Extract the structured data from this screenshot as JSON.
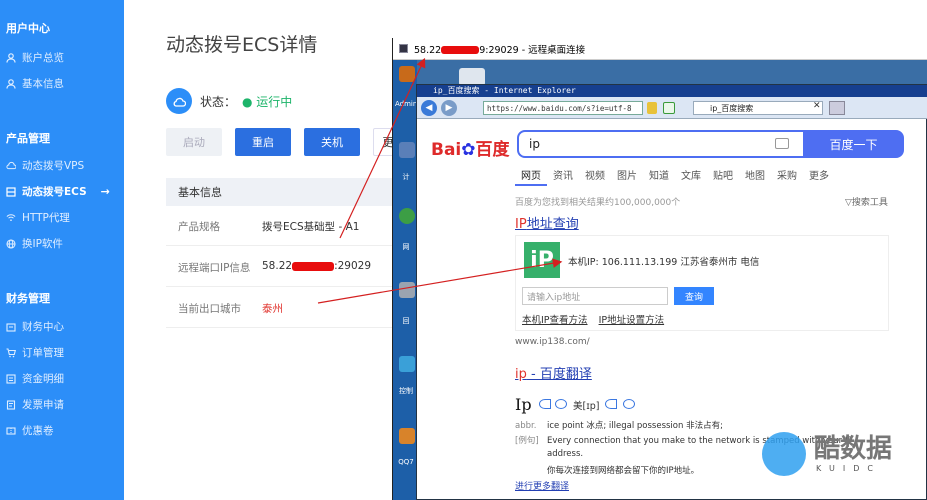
{
  "sidebar": {
    "sections": [
      {
        "title": "用户中心",
        "items": [
          {
            "label": "账户总览",
            "icon": "user-icon"
          },
          {
            "label": "基本信息",
            "icon": "person-icon"
          }
        ]
      },
      {
        "title": "产品管理",
        "items": [
          {
            "label": "动态拨号VPS",
            "icon": "cloud-icon"
          },
          {
            "label": "动态拨号ECS",
            "icon": "server-icon",
            "active": true
          },
          {
            "label": "HTTP代理",
            "icon": "wifi-icon"
          },
          {
            "label": "换IP软件",
            "icon": "globe-icon"
          }
        ]
      },
      {
        "title": "财务管理",
        "items": [
          {
            "label": "财务中心",
            "icon": "wallet-icon"
          },
          {
            "label": "订单管理",
            "icon": "cart-icon"
          },
          {
            "label": "资金明细",
            "icon": "list-icon"
          },
          {
            "label": "发票申请",
            "icon": "invoice-icon"
          },
          {
            "label": "优惠卷",
            "icon": "coupon-icon"
          }
        ]
      }
    ],
    "active_arrow": "→"
  },
  "main": {
    "title": "动态拨号ECS详情",
    "status_label": "状态：",
    "status_value": "运行中",
    "buttons": {
      "start": "启动",
      "restart": "重启",
      "shutdown": "关机",
      "partial": "更"
    },
    "info_header": "基本信息",
    "rows": [
      {
        "key": "产品规格",
        "value": "拨号ECS基础型 - A1"
      },
      {
        "key": "远程端口IP信息",
        "value_prefix": "58.22",
        "value_suffix": ":29029"
      },
      {
        "key": "当前出口城市",
        "value": "泰州"
      }
    ],
    "colors": {
      "sidebar": "#2c8ef8",
      "primary": "#2b6fe0",
      "running": "#1db46a",
      "city": "#e0322c"
    }
  },
  "remote": {
    "title_prefix": "58.22",
    "title_suffix": "9:29029 - 远程桌面连接",
    "desktop_labels": [
      "Admin",
      "计",
      "网",
      "回",
      "控制",
      "QQ7"
    ]
  },
  "ie": {
    "title": "ip_百度搜索 - Internet Explorer",
    "address": "https://www.baidu.com/s?ie=utf-8",
    "tab_label": "ip_百度搜索",
    "tab_close": "✕"
  },
  "baidu": {
    "logo_left": "Bai",
    "logo_right": "百度",
    "query": "ip",
    "search_button": "百度一下",
    "tabs": [
      "网页",
      "资讯",
      "视频",
      "图片",
      "知道",
      "文库",
      "贴吧",
      "地图",
      "采购",
      "更多"
    ],
    "result_count": "百度为您找到相关结果约100,000,000个",
    "search_tools": "搜索工具",
    "r1_title_hl": "IP",
    "r1_title_rest": "地址查询",
    "ip_logo": "iP",
    "ip_text": "本机IP: 106.111.13.199   江苏省泰州市 电信",
    "ip_input_placeholder": "请输入ip地址",
    "ip_query": "查询",
    "ip_links": [
      "本机IP查看方法",
      "IP地址设置方法"
    ],
    "ip_source": "www.ip138.com/",
    "r2_title_hl": "ip",
    "r2_title_rest": " - 百度翻译",
    "word": "Ip",
    "pron": "美[ɪp]",
    "defs": [
      {
        "k": "abbr.",
        "v": "ice point 冰点; illegal possession 非法占有;"
      },
      {
        "k": "[例句]",
        "v": "Every connection that you make to the network is stamped with your IP"
      },
      {
        "k": "",
        "v": "address."
      },
      {
        "k": "",
        "v": "你每次连接到网络都会留下你的IP地址。"
      }
    ],
    "more": "进行更多翻译"
  },
  "watermark": {
    "text": "酷数据",
    "sub": "KUIDC"
  }
}
